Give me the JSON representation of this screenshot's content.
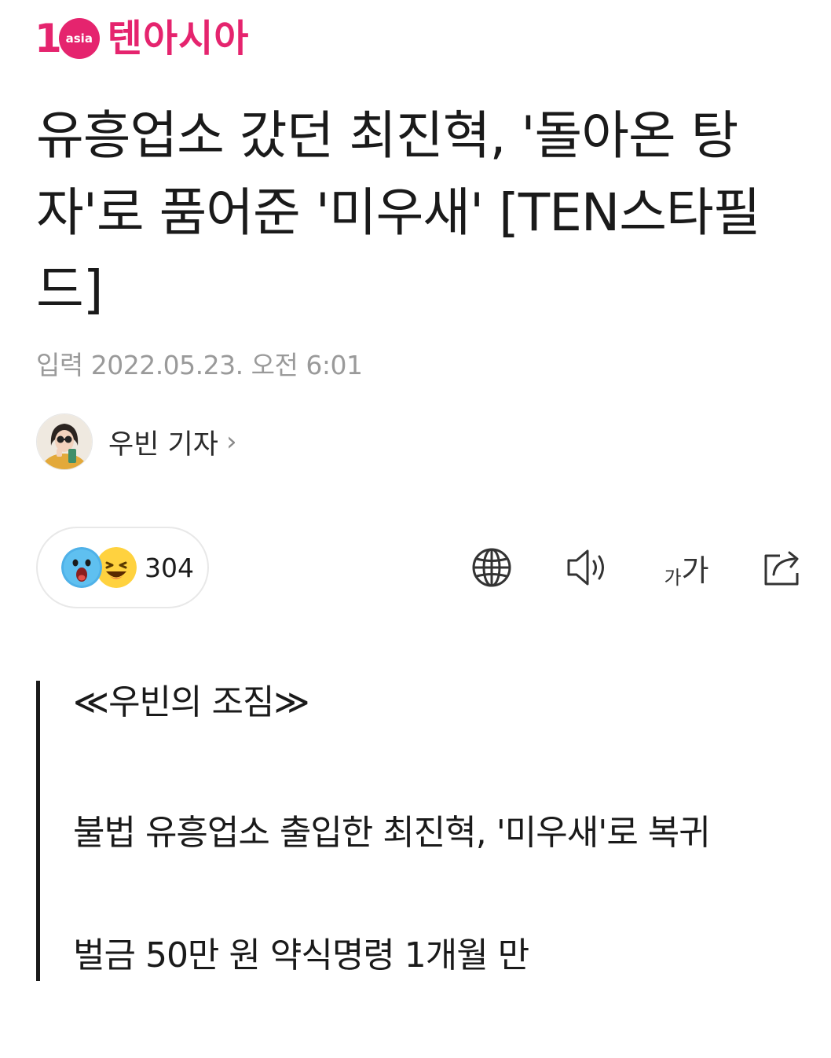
{
  "logo": {
    "number": "1",
    "circle_text": "asia",
    "name": "텐아시아"
  },
  "article": {
    "headline": "유흥업소 갔던 최진혁, '돌아온 탕자'로 품어준 '미우새' [TEN스타필드]",
    "date": "입력 2022.05.23. 오전 6:01"
  },
  "reporter": {
    "name": "우빈 기자",
    "chevron": "›"
  },
  "reactions": {
    "count": "304",
    "icons": [
      "surprised-emoji-icon",
      "laughing-emoji-icon"
    ]
  },
  "toolbar": {
    "icons": [
      "globe-icon",
      "speaker-icon",
      "font-size-icon",
      "share-icon"
    ],
    "font_small": "가",
    "font_large": "가"
  },
  "summary": {
    "title": "≪우빈의 조짐≫",
    "line1": "불법 유흥업소 출입한 최진혁, '미우새'로 복귀",
    "line2": "벌금 50만 원 약식명령 1개월 만"
  },
  "colors": {
    "brand": "#e5246e",
    "text": "#1a1a1a",
    "muted": "#9a9a9a"
  }
}
